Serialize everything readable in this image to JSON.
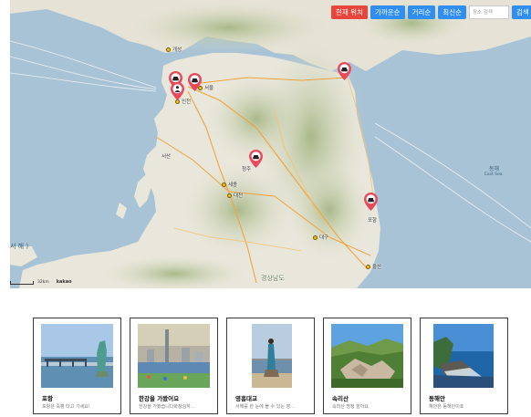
{
  "toolbar": {
    "current_location": "현재 위치",
    "nearest": "가까운순",
    "distance": "거리순",
    "latest": "최신순",
    "search_placeholder": "장소 검색",
    "search": "검색"
  },
  "map": {
    "attribution": "kakao",
    "scale_label": "32km",
    "labels": {
      "gaesong": "개성",
      "incheon": "인천",
      "seoul": "서울",
      "sejong": "세종",
      "daejeon": "대전",
      "daegu": "대구",
      "ulsan": "울산",
      "pohang": "포항",
      "donghae": "동해",
      "east_sea": "East Sea",
      "west_sea": "서 해 )",
      "gyeongsang": "경상남도",
      "seosan": "서산",
      "cheongju": "청주"
    }
  },
  "cards": [
    {
      "title": "포항",
      "desc": "포항은 죽뽕 타고 가세요!"
    },
    {
      "title": "한강을 가봤어요",
      "desc": "한강을 가봤습니다화창심하..."
    },
    {
      "title": "영흥대교",
      "desc": "서해를 한 눈에 볼 수 있는 영..."
    },
    {
      "title": "속리산",
      "desc": "속리산 명정 높아요"
    },
    {
      "title": "동해안",
      "desc": "해안은 동해안이죠"
    }
  ],
  "colors": {
    "sea": "#a9c3d6",
    "land": "#e9e7dc",
    "mountain": "#b9c79d",
    "marker": "#e9495b",
    "button_red": "#e8453c",
    "button_blue": "#2f8ef0"
  }
}
